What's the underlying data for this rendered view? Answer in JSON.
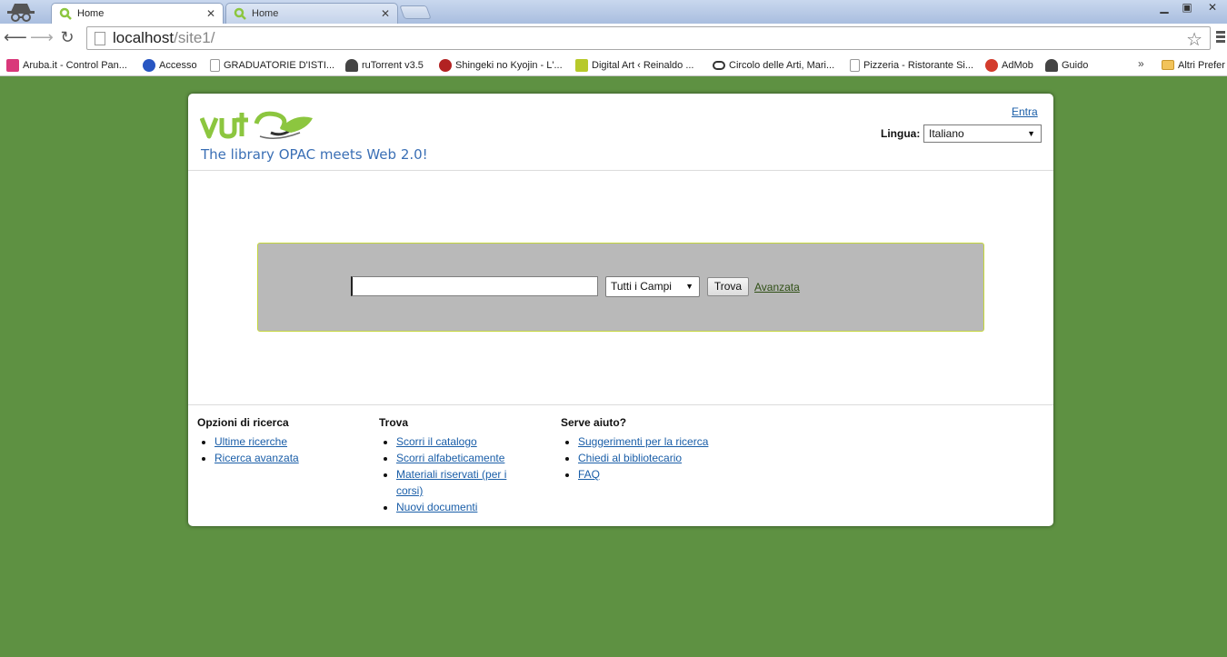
{
  "browser": {
    "tabs": [
      {
        "label": "Home",
        "active": true
      },
      {
        "label": "Home",
        "active": false
      }
    ],
    "window_controls": {
      "minimize": "▁",
      "maximize": "▣",
      "close": "✕"
    },
    "address": {
      "host": "localhost",
      "path": "/site1/"
    },
    "bookmarks": [
      {
        "label": "Aruba.it - Control Pan...",
        "icon": "aruba-icon",
        "color": "#d9387a"
      },
      {
        "label": "Accesso",
        "icon": "info-icon",
        "color": "#2856c2"
      },
      {
        "label": "GRADUATORIE D'ISTI...",
        "icon": "page-icon",
        "color": "#ffffff"
      },
      {
        "label": "ruTorrent v3.5",
        "icon": "rutorrent-icon",
        "color": "#444444"
      },
      {
        "label": "Shingeki no Kyojin - L'...",
        "icon": "shingeki-icon",
        "color": "#b22222"
      },
      {
        "label": "Digital Art ‹ Reinaldo ...",
        "icon": "digitalart-icon",
        "color": "#b7c92a"
      },
      {
        "label": "Circolo delle Arti, Mari...",
        "icon": "tripadvisor-icon",
        "color": "#333333"
      },
      {
        "label": "Pizzeria - Ristorante Si...",
        "icon": "page-icon",
        "color": "#ffffff"
      },
      {
        "label": "AdMob",
        "icon": "admob-icon",
        "color": "#d33b2c"
      },
      {
        "label": "Guido",
        "icon": "guido-icon",
        "color": "#444444"
      }
    ],
    "more_bookmarks": "»",
    "other_bookmarks": "Altri Prefer"
  },
  "header": {
    "tagline": "The library OPAC meets Web 2.0!",
    "login": "Entra",
    "language_label": "Lingua:",
    "language_value": "Italiano"
  },
  "search": {
    "query": "",
    "field_value": "Tutti i Campi",
    "submit": "Trova",
    "advanced": "Avanzata"
  },
  "footer": {
    "col1": {
      "title": "Opzioni di ricerca",
      "links": [
        "Ultime ricerche",
        "Ricerca avanzata"
      ]
    },
    "col2": {
      "title": "Trova",
      "links": [
        "Scorri il catalogo",
        "Scorri alfabeticamente",
        "Materiali riservati (per i corsi)",
        "Nuovi documenti"
      ]
    },
    "col3": {
      "title": "Serve aiuto?",
      "links": [
        "Suggerimenti per la ricerca",
        "Chiedi al bibliotecario",
        "FAQ"
      ]
    }
  },
  "colors": {
    "page_bg": "#5e9142",
    "search_panel": "#b9b9b9",
    "link": "#1a5ea8",
    "tagline": "#3a6fb5",
    "logo_green": "#8cc63f"
  }
}
